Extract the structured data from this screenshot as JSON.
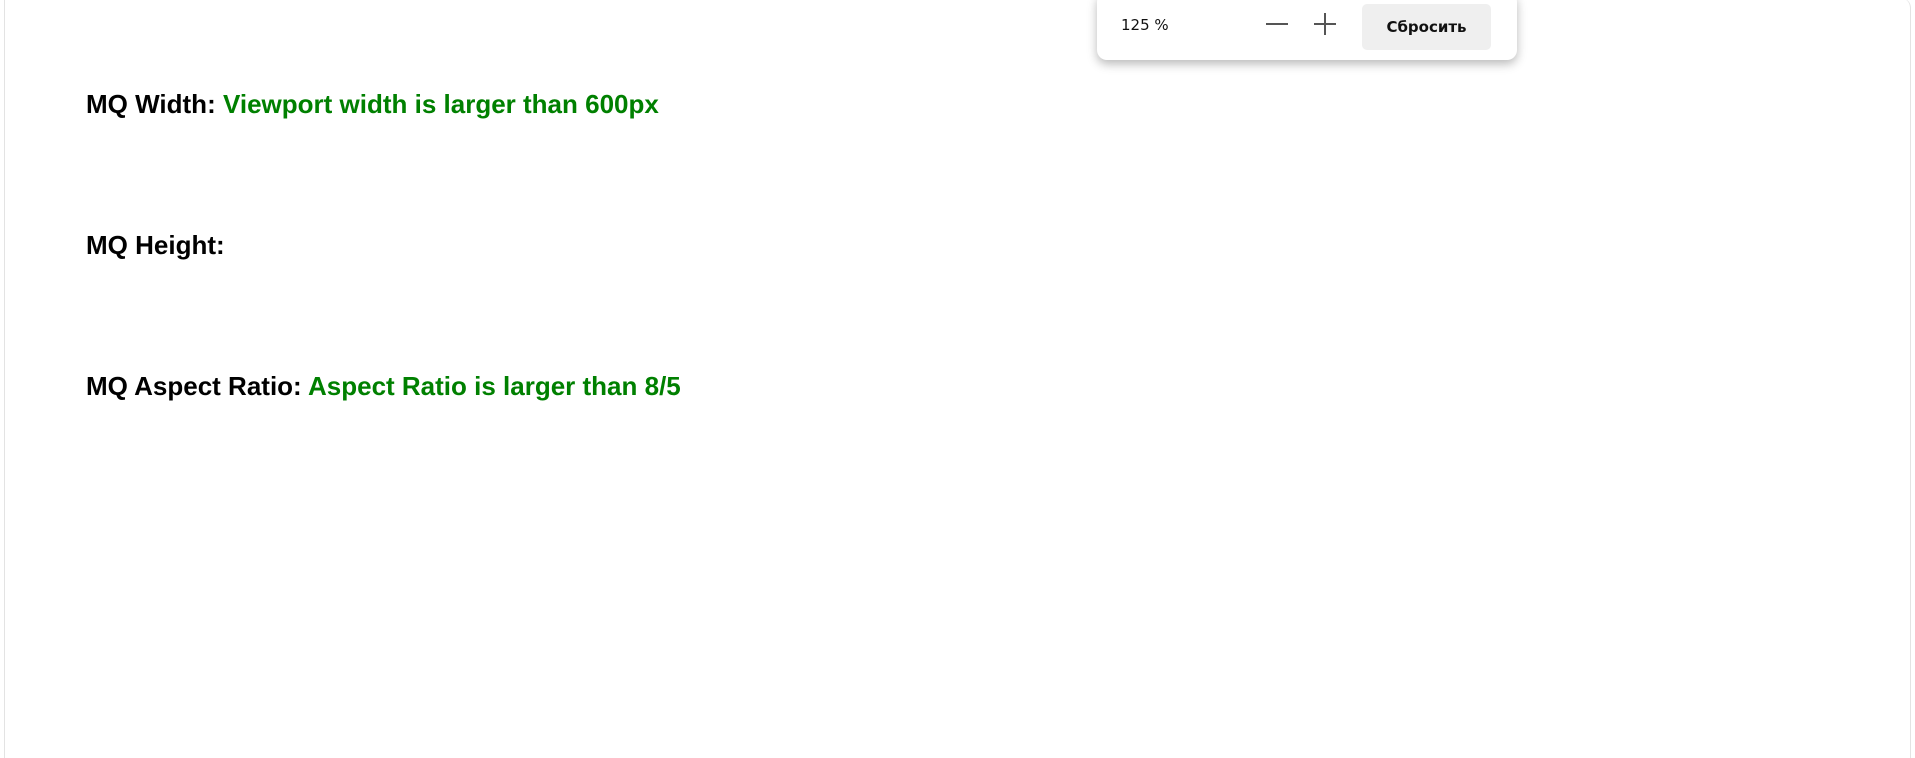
{
  "content": {
    "width": {
      "label": "MQ Width:",
      "value": "Viewport width is larger than 600px"
    },
    "height": {
      "label": "MQ Height:",
      "value": ""
    },
    "aspect": {
      "label": "MQ Aspect Ratio:",
      "value": "Aspect Ratio is larger than 8/5"
    },
    "value_color": "#008000"
  },
  "zoom_popup": {
    "level": "125 %",
    "zoom_out_icon": "minus-icon",
    "zoom_in_icon": "plus-icon",
    "reset_label": "Сбросить"
  }
}
